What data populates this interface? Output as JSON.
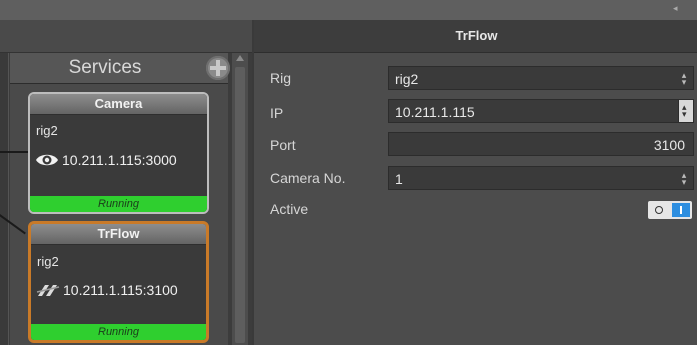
{
  "left_panel": {
    "title": "Services",
    "services": [
      {
        "name": "Camera",
        "rig": "rig2",
        "address": "10.211.1.115:3000",
        "icon": "eye-icon",
        "status": "Running"
      },
      {
        "name": "TrFlow",
        "rig": "rig2",
        "address": "10.211.1.115:3100",
        "icon": "flow-icon",
        "status": "Running"
      }
    ]
  },
  "right_panel": {
    "title": "TrFlow",
    "properties": {
      "rig": {
        "label": "Rig",
        "value": "rig2"
      },
      "ip": {
        "label": "IP",
        "value": "10.211.1.115"
      },
      "port": {
        "label": "Port",
        "value": "3100"
      },
      "camera": {
        "label": "Camera No.",
        "value": "1"
      },
      "active": {
        "label": "Active",
        "value": true
      }
    }
  },
  "colors": {
    "running": "#2fcf2f",
    "selected_border": "#c97a28",
    "toggle_on": "#2d8ee0"
  }
}
